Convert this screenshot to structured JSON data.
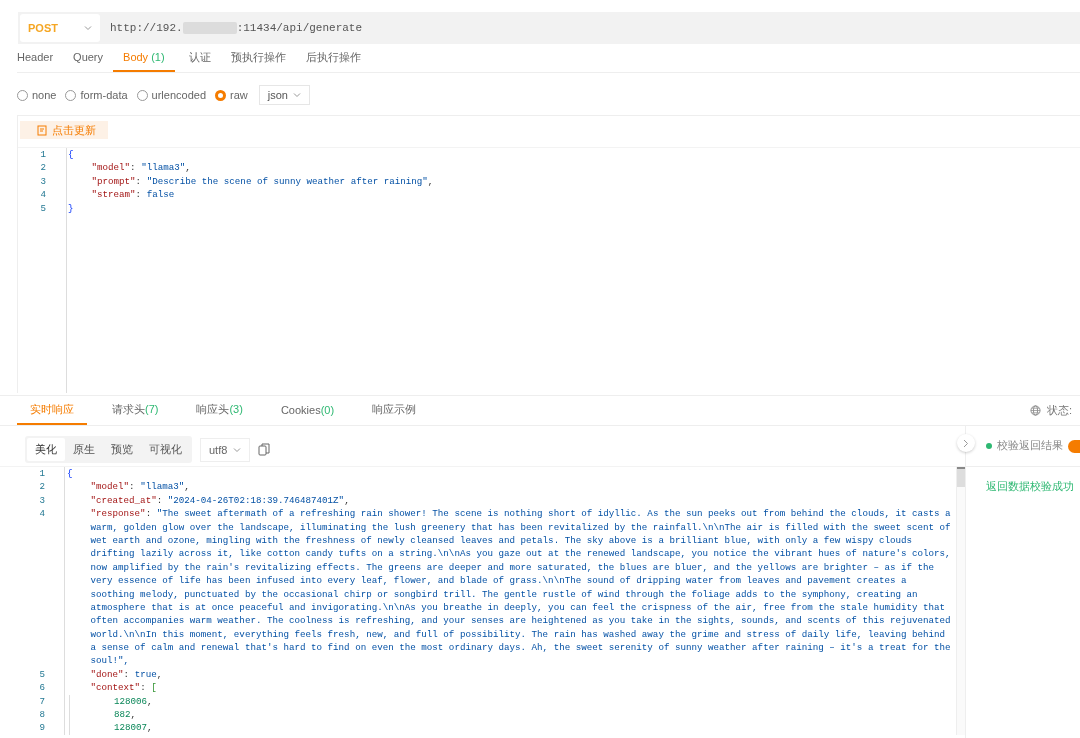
{
  "request": {
    "method": "POST",
    "url_start": "http://192.",
    "url_end": ":11434/api/generate"
  },
  "request_tabs": [
    {
      "label": "Header",
      "selected": false
    },
    {
      "label": "Query",
      "selected": false
    },
    {
      "label": "Body",
      "count": "(1)",
      "selected": true
    },
    {
      "label": "认证",
      "selected": false
    },
    {
      "label": "预执行操作",
      "selected": false
    },
    {
      "label": "后执行操作",
      "selected": false
    }
  ],
  "body_types": [
    {
      "label": "none",
      "selected": false
    },
    {
      "label": "form-data",
      "selected": false
    },
    {
      "label": "urlencoded",
      "selected": false
    },
    {
      "label": "raw",
      "selected": true
    }
  ],
  "format": "json",
  "update_button": "点击更新",
  "request_code": [
    {
      "number": "1",
      "segments": [
        {
          "kind": "bracket",
          "text": "{"
        }
      ],
      "children": [
        {
          "number": "2",
          "segments": [
            {
              "kind": "key",
              "text": "\"model\""
            },
            {
              "kind": "punct",
              "text": ": "
            },
            {
              "kind": "string",
              "text": "\"llama3\""
            },
            {
              "kind": "punct",
              "text": ","
            }
          ]
        },
        {
          "number": "3",
          "segments": [
            {
              "kind": "key",
              "text": "\"prompt\""
            },
            {
              "kind": "punct",
              "text": ": "
            },
            {
              "kind": "string",
              "text": "\"Describe the scene of sunny weather after raining\""
            },
            {
              "kind": "punct",
              "text": ","
            }
          ]
        },
        {
          "number": "4",
          "segments": [
            {
              "kind": "key",
              "text": "\"stream\""
            },
            {
              "kind": "punct",
              "text": ": "
            },
            {
              "kind": "literal",
              "text": "false"
            }
          ]
        }
      ]
    },
    {
      "number": "5",
      "segments": [
        {
          "kind": "bracket",
          "text": "}"
        }
      ]
    }
  ],
  "response_tabs": [
    {
      "label": "实时响应",
      "selected": true
    },
    {
      "label": "请求头",
      "count": "(7)",
      "selected": false
    },
    {
      "label": "响应头",
      "count": "(3)",
      "selected": false
    },
    {
      "label": "Cookies",
      "count": "(0)",
      "selected": false
    },
    {
      "label": "响应示例",
      "selected": false
    }
  ],
  "status_label": "状态:",
  "view_modes": [
    {
      "label": "美化",
      "selected": true
    },
    {
      "label": "原生",
      "selected": false
    },
    {
      "label": "预览",
      "selected": false
    },
    {
      "label": "可视化",
      "selected": false
    }
  ],
  "encoding": "utf8",
  "validation": {
    "label": "校验返回结果",
    "on": true,
    "result": "返回数据校验成功"
  },
  "response_code": [
    {
      "number": "1",
      "segments": [
        {
          "kind": "bracket",
          "text": "{"
        }
      ],
      "children": [
        {
          "number": "2",
          "segments": [
            {
              "kind": "key",
              "text": "\"model\""
            },
            {
              "kind": "punct",
              "text": ": "
            },
            {
              "kind": "string",
              "text": "\"llama3\""
            },
            {
              "kind": "punct",
              "text": ","
            }
          ]
        },
        {
          "number": "3",
          "segments": [
            {
              "kind": "key",
              "text": "\"created_at\""
            },
            {
              "kind": "punct",
              "text": ": "
            },
            {
              "kind": "string",
              "text": "\"2024-04-26T02:18:39.746487401Z\""
            },
            {
              "kind": "punct",
              "text": ","
            }
          ]
        },
        {
          "number": "4",
          "segments": [
            {
              "kind": "key",
              "text": "\"response\""
            },
            {
              "kind": "punct",
              "text": ": "
            },
            {
              "kind": "string",
              "text": "\"The sweet aftermath of a refreshing rain shower! The scene is nothing short of idyllic. As the sun peeks out from behind the clouds, it casts a"
            }
          ],
          "continuation": [
            "warm, golden glow over the landscape, illuminating the lush greenery that has been revitalized by the rainfall.\\n\\nThe air is filled with the sweet scent of",
            "wet earth and ozone, mingling with the freshness of newly cleansed leaves and petals. The sky above is a brilliant blue, with only a few wispy clouds",
            "drifting lazily across it, like cotton candy tufts on a string.\\n\\nAs you gaze out at the renewed landscape, you notice the vibrant hues of nature's colors,",
            "now amplified by the rain's revitalizing effects. The greens are deeper and more saturated, the blues are bluer, and the yellows are brighter – as if the",
            "very essence of life has been infused into every leaf, flower, and blade of grass.\\n\\nThe sound of dripping water from leaves and pavement creates a",
            "soothing melody, punctuated by the occasional chirp or songbird trill. The gentle rustle of wind through the foliage adds to the symphony, creating an",
            "atmosphere that is at once peaceful and invigorating.\\n\\nAs you breathe in deeply, you can feel the crispness of the air, free from the stale humidity that",
            "often accompanies warm weather. The coolness is refreshing, and your senses are heightened as you take in the sights, sounds, and scents of this rejuvenated",
            "world.\\n\\nIn this moment, everything feels fresh, new, and full of possibility. The rain has washed away the grime and stress of daily life, leaving behind",
            "a sense of calm and renewal that's hard to find on even the most ordinary days. Ah, the sweet serenity of sunny weather after raining – it's a treat for the",
            "soul!\","
          ]
        },
        {
          "number": "5",
          "segments": [
            {
              "kind": "key",
              "text": "\"done\""
            },
            {
              "kind": "punct",
              "text": ": "
            },
            {
              "kind": "literal",
              "text": "true"
            },
            {
              "kind": "punct",
              "text": ","
            }
          ]
        },
        {
          "number": "6",
          "segments": [
            {
              "kind": "key",
              "text": "\"context\""
            },
            {
              "kind": "punct",
              "text": ": "
            },
            {
              "kind": "array",
              "text": "["
            }
          ],
          "children": [
            {
              "number": "7",
              "segments": [
                {
                  "kind": "number",
                  "text": "128006"
                },
                {
                  "kind": "punct",
                  "text": ","
                }
              ]
            },
            {
              "number": "8",
              "segments": [
                {
                  "kind": "number",
                  "text": "882"
                },
                {
                  "kind": "punct",
                  "text": ","
                }
              ]
            },
            {
              "number": "9",
              "segments": [
                {
                  "kind": "number",
                  "text": "128007"
                },
                {
                  "kind": "punct",
                  "text": ","
                }
              ]
            }
          ]
        }
      ]
    }
  ]
}
